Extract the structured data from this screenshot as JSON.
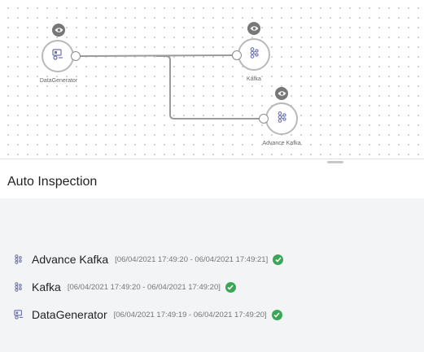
{
  "canvas": {
    "nodes": [
      {
        "id": "datagenerator",
        "label": "DataGenerator",
        "icon": "datagenerator-icon"
      },
      {
        "id": "kafka",
        "label": "Kafka",
        "icon": "kafka-icon"
      },
      {
        "id": "advance_kafka",
        "label": "Advance Kafka",
        "icon": "kafka-icon"
      }
    ]
  },
  "panel": {
    "title": "Auto Inspection",
    "results": [
      {
        "name": "Advance Kafka",
        "time": "[06/04/2021 17:49:20 - 06/04/2021 17:49:21]",
        "icon": "kafka-icon",
        "status": "success"
      },
      {
        "name": "Kafka",
        "time": "[06/04/2021 17:49:20 - 06/04/2021 17:49:20]",
        "icon": "kafka-icon",
        "status": "success"
      },
      {
        "name": "DataGenerator",
        "time": "[06/04/2021 17:49:19 - 06/04/2021 17:49:20]",
        "icon": "datagenerator-icon",
        "status": "success"
      }
    ]
  },
  "colors": {
    "success": "#3aa757",
    "icon_accent": "#6a6fb3"
  }
}
